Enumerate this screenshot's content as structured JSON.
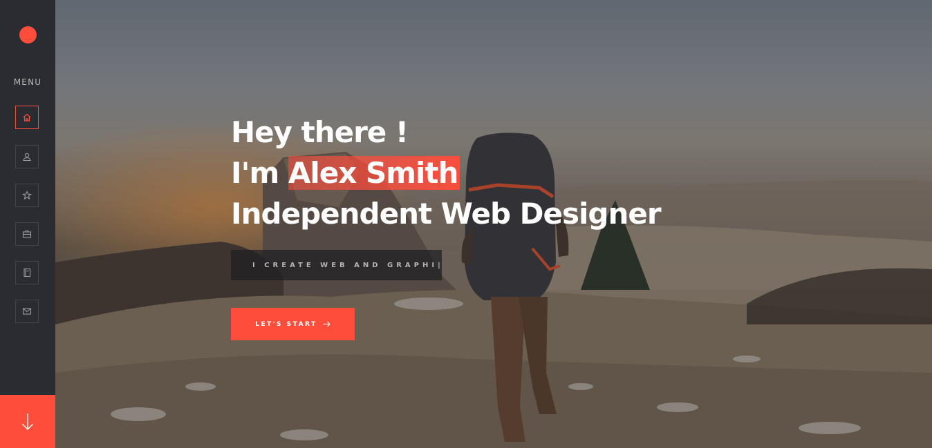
{
  "sidebar": {
    "menu_label": "MENU",
    "nav": [
      {
        "icon": "home-icon",
        "active": true
      },
      {
        "icon": "user-icon",
        "active": false
      },
      {
        "icon": "star-icon",
        "active": false
      },
      {
        "icon": "briefcase-icon",
        "active": false
      },
      {
        "icon": "book-icon",
        "active": false
      },
      {
        "icon": "mail-icon",
        "active": false
      }
    ],
    "scroll_icon": "arrow-down-icon"
  },
  "hero": {
    "line1": "Hey there !",
    "line2_prefix": "I'm ",
    "name": "Alex Smith",
    "line3": "Independent Web Designer",
    "tagline": "I CREATE WEB AND GRAPHI|",
    "cta_label": "LET'S START",
    "cta_icon": "arrow-right-icon"
  },
  "colors": {
    "accent": "#ff4d3c",
    "sidebar_bg": "#2b2c31"
  }
}
